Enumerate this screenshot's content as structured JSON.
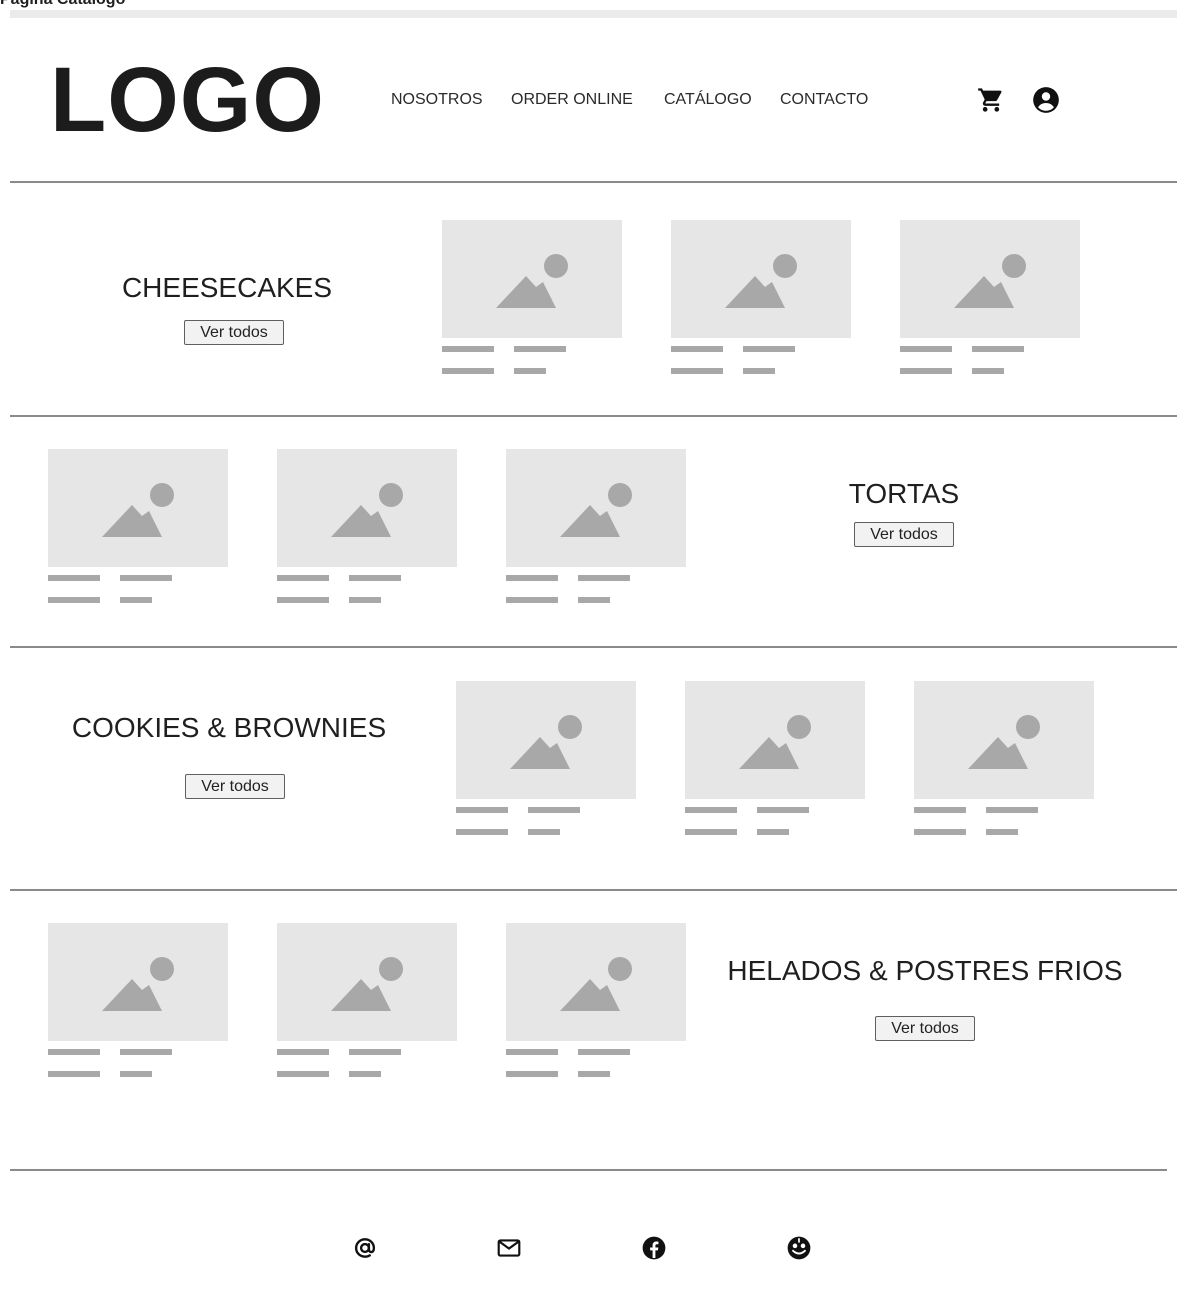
{
  "window": {
    "title": "Página Catálogo"
  },
  "header": {
    "logo": "LOGO",
    "nav": [
      "NOSOTROS",
      "ORDER ONLINE",
      "CATÁLOGO",
      "CONTACTO"
    ],
    "icons": [
      "cart-icon",
      "account-circle-icon"
    ]
  },
  "sections": [
    {
      "title": "CHEESECAKES",
      "button": "Ver todos"
    },
    {
      "title": "TORTAS",
      "button": "Ver todos"
    },
    {
      "title": "COOKIES & BROWNIES",
      "button": "Ver todos"
    },
    {
      "title": "HELADOS & POSTRES FRIOS",
      "button": "Ver todos"
    }
  ],
  "product_card": {
    "icon": "image-placeholder-icon"
  },
  "footer": {
    "icons": [
      "at-sign-icon",
      "mail-icon",
      "facebook-icon",
      "social-icon"
    ]
  },
  "colors": {
    "text": "#1f1f1f",
    "divider": "#8a8a8a",
    "placeholder_bg": "#e6e6e6",
    "placeholder_fg": "#a8a8a8",
    "button_bg": "#f2f2f2"
  }
}
